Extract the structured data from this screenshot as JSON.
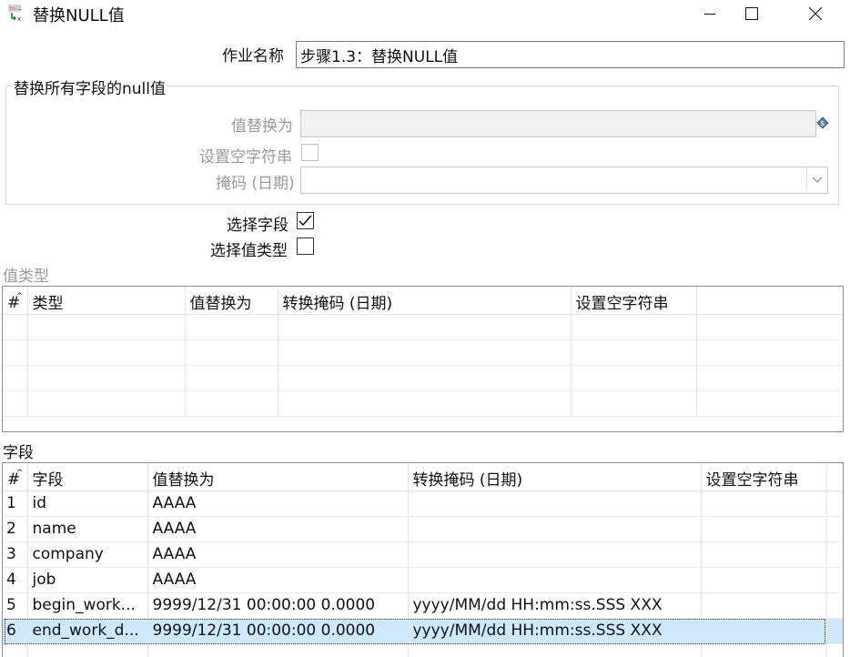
{
  "window": {
    "title": "替换NULL值",
    "icon": "null-replace-icon",
    "minimize_icon": "minimize-icon",
    "maximize_icon": "maximize-icon",
    "close_icon": "close-icon"
  },
  "job_name": {
    "label": "作业名称",
    "value": "步骤1.3：替换NULL值"
  },
  "replace_all": {
    "legend": "替换所有字段的null值",
    "value_label": "值替换为",
    "value": "",
    "empty_string_label": "设置空字符串",
    "mask_label": "掩码 (日期)",
    "mask_value": "",
    "variable_icon": "variable-icon"
  },
  "select_field": {
    "label": "选择字段",
    "checked": true
  },
  "select_value_type": {
    "label": "选择值类型",
    "checked": false
  },
  "value_types": {
    "section_label": "值类型",
    "columns": [
      "#",
      "类型",
      "值替换为",
      "转换掩码 (日期)",
      "设置空字符串"
    ],
    "rows": []
  },
  "fields": {
    "section_label": "字段",
    "columns": [
      "#",
      "字段",
      "值替换为",
      "转换掩码 (日期)",
      "设置空字符串"
    ],
    "rows": [
      {
        "num": "1",
        "field": "id",
        "value": "AAAA",
        "mask": "",
        "empty": ""
      },
      {
        "num": "2",
        "field": "name",
        "value": "AAAA",
        "mask": "",
        "empty": ""
      },
      {
        "num": "3",
        "field": "company",
        "value": "AAAA",
        "mask": "",
        "empty": ""
      },
      {
        "num": "4",
        "field": "job",
        "value": "AAAA",
        "mask": "",
        "empty": ""
      },
      {
        "num": "5",
        "field": "begin_work...",
        "value": "9999/12/31 00:00:00 0.0000",
        "mask": "yyyy/MM/dd HH:mm:ss.SSS XXX",
        "empty": ""
      },
      {
        "num": "6",
        "field": "end_work_d...",
        "value": "9999/12/31 00:00:00 0.0000",
        "mask": "yyyy/MM/dd HH:mm:ss.SSS XXX",
        "empty": ""
      }
    ],
    "selected_row": 6
  },
  "colors": {
    "selection": "#cde8ff",
    "disabled_text": "#9a9a9a"
  }
}
